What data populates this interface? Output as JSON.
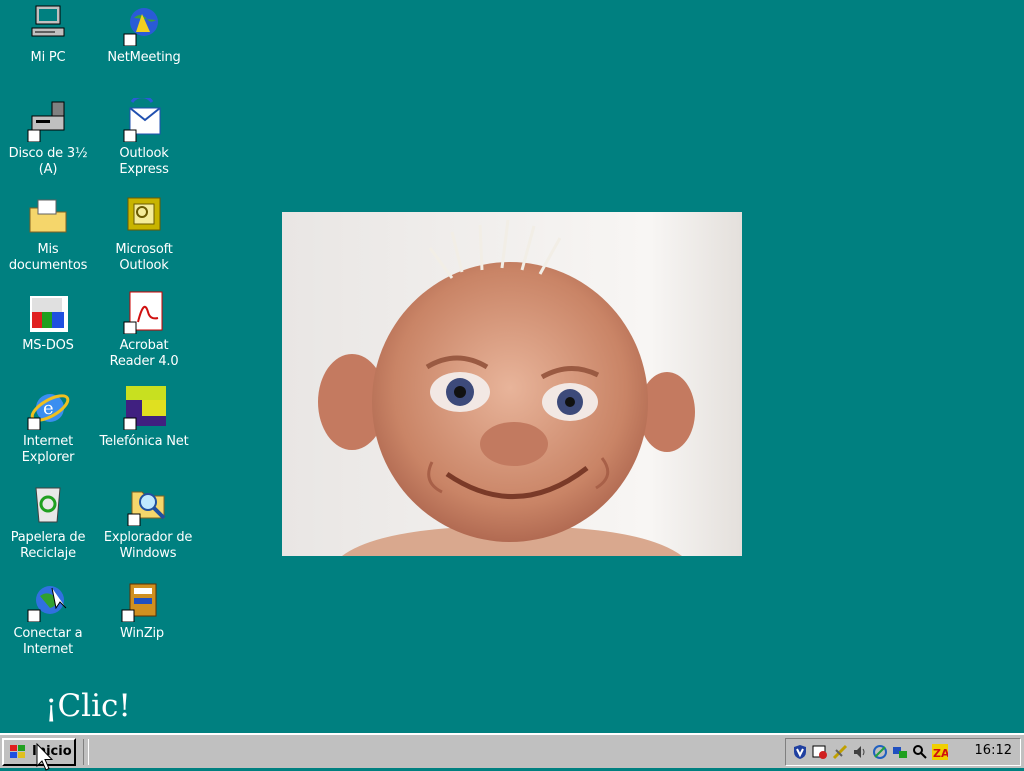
{
  "desktop": {
    "icons": [
      {
        "label": "Mi PC"
      },
      {
        "label": "NetMeeting"
      },
      {
        "label": "Disco de 3½ (A)"
      },
      {
        "label": "Outlook Express"
      },
      {
        "label": "Mis documentos"
      },
      {
        "label": "Microsoft Outlook"
      },
      {
        "label": "MS-DOS"
      },
      {
        "label": "Acrobat Reader 4.0"
      },
      {
        "label": "Internet Explorer"
      },
      {
        "label": "Telefónica Net"
      },
      {
        "label": "Papelera de Reciclaje"
      },
      {
        "label": "Explorador de Windows"
      },
      {
        "label": "Conectar a Internet"
      },
      {
        "label": "WinZip"
      }
    ],
    "caption": "¡Clic!"
  },
  "taskbar": {
    "start_label": "Inicio",
    "clock": "16:12"
  },
  "colors": {
    "desktop": "#008080",
    "taskbar": "#c0c0c0"
  }
}
